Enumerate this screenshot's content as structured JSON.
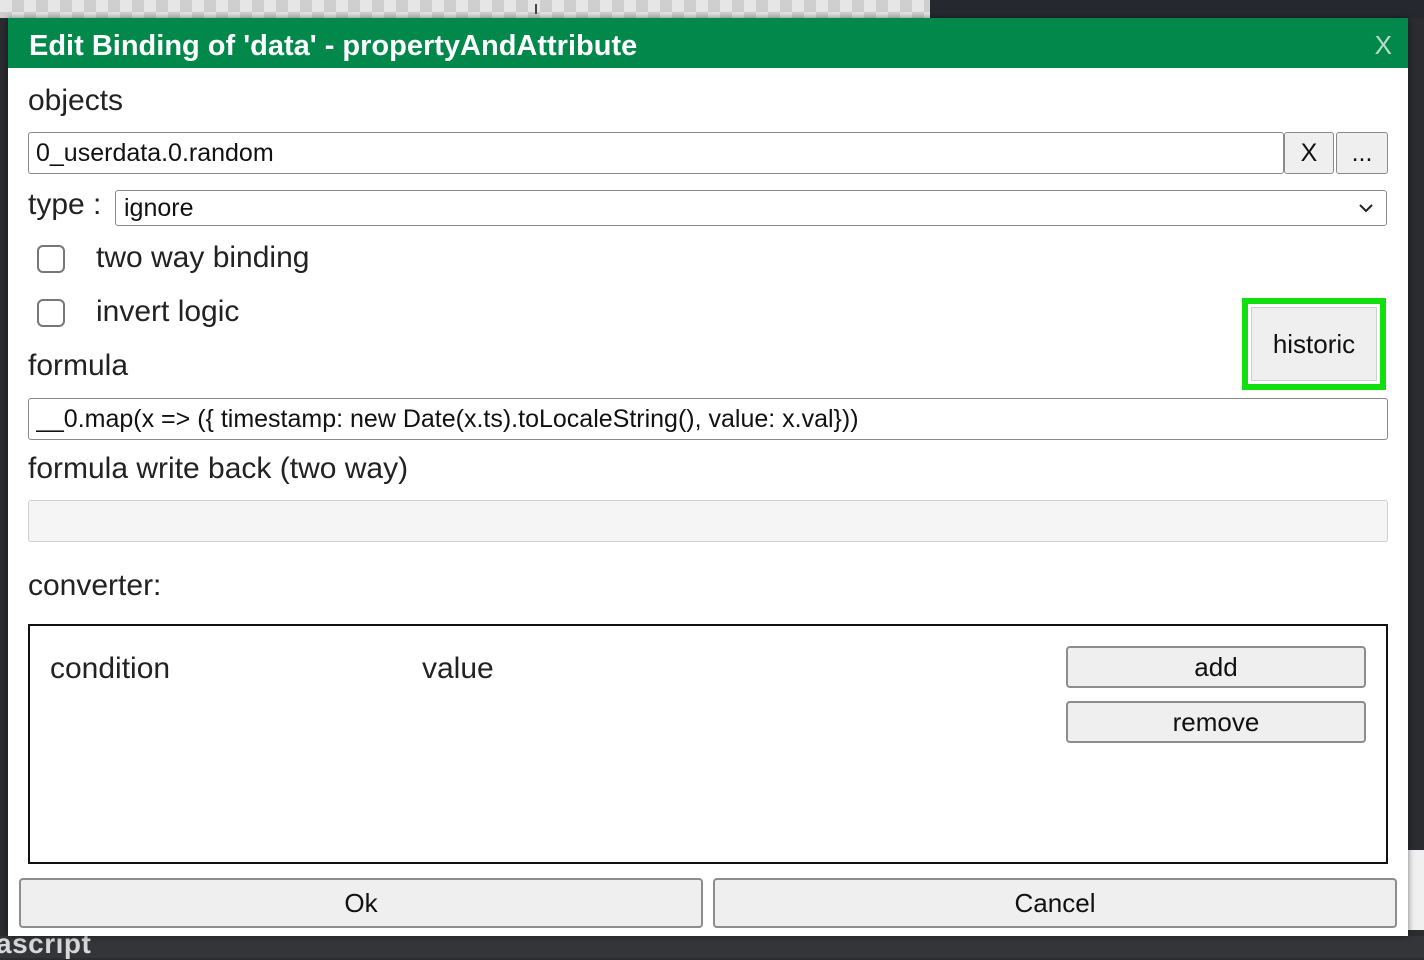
{
  "dialog": {
    "title": "Edit Binding of 'data' - propertyAndAttribute",
    "close_label": "X"
  },
  "objects": {
    "label": "objects",
    "value": "0_userdata.0.random",
    "clear_label": "X",
    "browse_label": "..."
  },
  "type": {
    "label": "type :",
    "selected": "ignore"
  },
  "options": {
    "two_way_label": "two way binding",
    "two_way_checked": false,
    "invert_label": "invert logic",
    "invert_checked": false
  },
  "historic_label": "historic",
  "formula": {
    "label": "formula",
    "value": "__0.map(x => ({ timestamp: new Date(x.ts).toLocaleString(), value: x.val}))"
  },
  "formula_write_back": {
    "label": "formula write back (two way)",
    "value": ""
  },
  "converter": {
    "label": "converter:",
    "columns": [
      "condition",
      "value"
    ],
    "add_label": "add",
    "remove_label": "remove"
  },
  "footer": {
    "ok_label": "Ok",
    "cancel_label": "Cancel"
  },
  "background": {
    "partial_text": "ascript"
  },
  "colors": {
    "titlebar": "#03884b",
    "highlight": "#10e010"
  }
}
